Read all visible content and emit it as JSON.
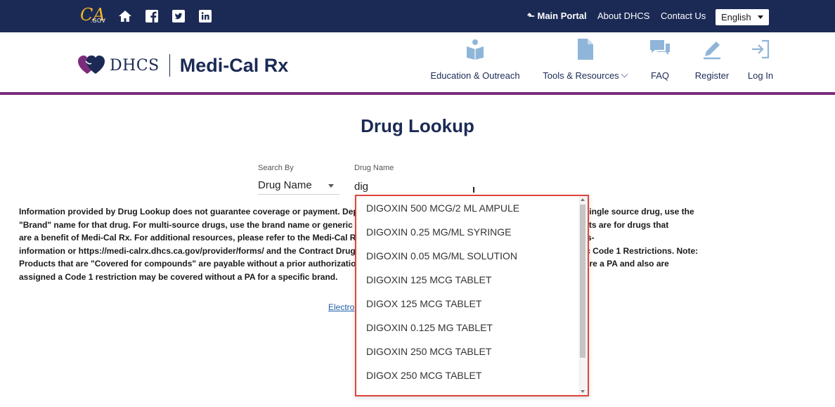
{
  "topbar": {
    "ca_logo_text": "CA",
    "gov_text": ".GOV",
    "main_portal": "Main Portal",
    "about": "About DHCS",
    "contact": "Contact Us",
    "language": "English",
    "bg_color": "#1b2a55",
    "icons": [
      "home-icon",
      "facebook-icon",
      "twitter-icon",
      "linkedin-icon"
    ]
  },
  "header": {
    "dhcs": "DHCS",
    "product": "Medi-Cal Rx",
    "accent_color": "#7b2d7b",
    "nav": [
      {
        "label": "Education & Outreach",
        "icon": "education-icon"
      },
      {
        "label": "Tools & Resources",
        "icon": "document-icon"
      },
      {
        "label": "FAQ",
        "icon": "chat-icon"
      },
      {
        "label": "Register",
        "icon": "pencil-icon"
      },
      {
        "label": "Log In",
        "icon": "login-icon"
      }
    ]
  },
  "main": {
    "title": "Drug Lookup",
    "search_by_label": "Search By",
    "search_by_value": "Drug Name",
    "drug_name_label": "Drug Name",
    "drug_name_value": "dig",
    "info_lines": [
      "Information provided by Drug Lookup does not guarantee coverage or payment. Department of Health Care Services (DHCS). To search for a single source drug, use the",
      "\"Brand\" name for that drug. For multi-source drugs, use the brand name or generic name or search using the 11 digit NDC. Drug Lookup results are for drugs that",
      "are a benefit of Medi-Cal Rx. For additional resources, please refer to the Medi-Cal Rx Web Portal https://medi-calrx.dhcs.ca.gov/member/forms-",
      "information or https://medi-calrx.dhcs.ca.gov/provider/forms/ and the Contract Drugs List https://medi-calrx.dhcs.ca.gov/home/cdl/ for specific Code 1 Restrictions. Note:",
      "Products that are \"Covered for compounds\" are payable without a prior authorization when billed on a compound drug claim. Drugs that require a PA and also are",
      "assigned a Code 1 restriction may be covered without a PA for a specific brand."
    ],
    "electronic_link": "Electro"
  },
  "dropdown": {
    "highlight_color": "#e0443c",
    "items": [
      "DIGOXIN 500 MCG/2 ML AMPULE",
      "DIGOXIN 0.25 MG/ML SYRINGE",
      "DIGOXIN 0.05 MG/ML SOLUTION",
      "DIGOXIN 125 MCG TABLET",
      "DIGOX 125 MCG TABLET",
      "DIGOXIN 0.125 MG TABLET",
      "DIGOXIN 250 MCG TABLET",
      "DIGOX 250 MCG TABLET"
    ]
  }
}
